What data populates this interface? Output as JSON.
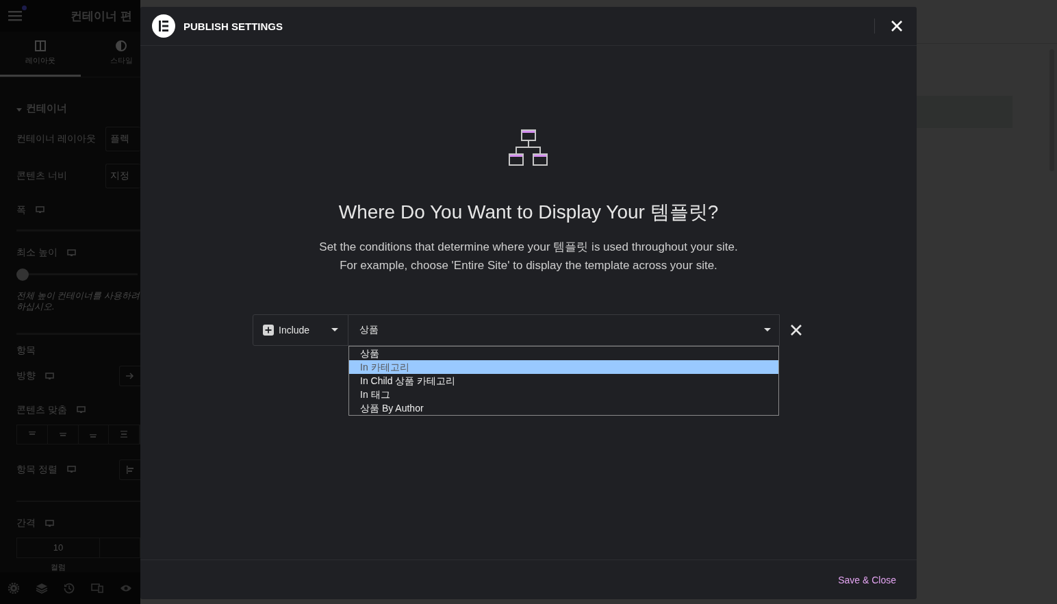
{
  "sidebar": {
    "title": "컨테이너 편",
    "tabs": [
      {
        "label": "레이아웃",
        "selected": true
      },
      {
        "label": "스타일",
        "selected": false
      }
    ],
    "section": {
      "title": "컨테이너",
      "expanded": true
    },
    "controls": [
      {
        "kind": "select",
        "label": "컨테이너 레이아웃",
        "value": "플렉"
      },
      {
        "kind": "select",
        "label": "콘텐츠 너비",
        "value": "지정"
      },
      {
        "kind": "responsive",
        "label": "폭"
      },
      {
        "kind": "slider",
        "label": "최소 높이",
        "level": 0
      },
      {
        "kind": "hint",
        "lines": [
          "전체 높이 컨테이너를 사용하려",
          "하십시오."
        ]
      },
      {
        "kind": "heading",
        "label": "항목"
      },
      {
        "kind": "arrow",
        "label": "방향"
      },
      {
        "kind": "responsive",
        "label": "콘텐츠 맞춤"
      },
      {
        "kind": "align-group"
      },
      {
        "kind": "align",
        "label": "항목 정렬"
      },
      {
        "kind": "responsive",
        "label": "간격"
      },
      {
        "kind": "gap",
        "value": "10",
        "caption": "컬럼"
      }
    ]
  },
  "dialog": {
    "title": "PUBLISH SETTINGS",
    "heading": "Where Do You Want to Display Your 템플릿?",
    "description": [
      "Set the conditions that determine where your 템플릿 is used throughout your site.",
      "For example, choose 'Entire Site' to display the template across your site."
    ],
    "condition": {
      "type": "Include",
      "value": "상품",
      "expanded": true,
      "options": [
        {
          "label": "상품",
          "highlighted": false
        },
        {
          "label": "In 카테고리",
          "highlighted": true
        },
        {
          "label": "In Child 상품 카테고리",
          "highlighted": false
        },
        {
          "label": "In 태그",
          "highlighted": false
        },
        {
          "label": "상품 By Author",
          "highlighted": false
        }
      ]
    },
    "save_button": "Save & Close"
  }
}
